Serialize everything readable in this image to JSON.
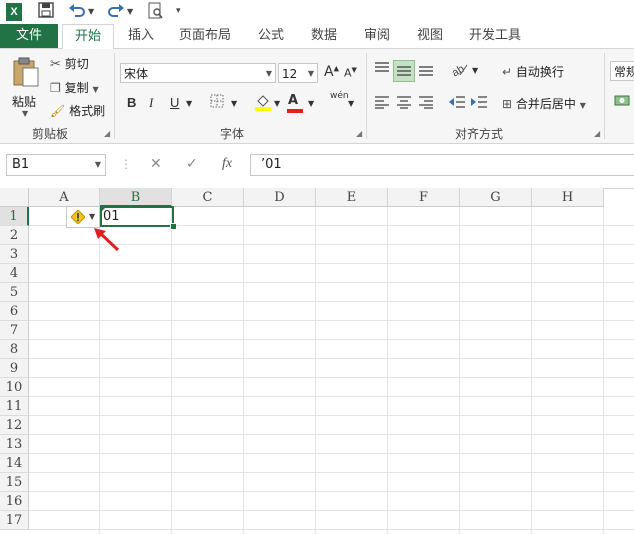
{
  "qat": {
    "excel_icon": "X"
  },
  "tabs": [
    {
      "label": "文件"
    },
    {
      "label": "开始"
    },
    {
      "label": "插入"
    },
    {
      "label": "页面布局"
    },
    {
      "label": "公式"
    },
    {
      "label": "数据"
    },
    {
      "label": "审阅"
    },
    {
      "label": "视图"
    },
    {
      "label": "开发工具"
    }
  ],
  "ribbon": {
    "clipboard": {
      "paste": "粘贴",
      "cut": "剪切",
      "copy": "复制",
      "format_painter": "格式刷",
      "label": "剪贴板"
    },
    "font": {
      "name": "宋体",
      "size": "12",
      "bold": "B",
      "italic": "I",
      "underline": "U",
      "grow": "A",
      "shrink": "A",
      "label": "字体",
      "font_color_glyph": "A",
      "phonetic": "wén"
    },
    "align": {
      "wrap": "自动换行",
      "merge": "合并后居中",
      "label": "对齐方式"
    },
    "number": {
      "format": "常规"
    }
  },
  "formula_bar": {
    "name_box": "B1",
    "cancel": "✕",
    "enter": "✓",
    "fx": "fx",
    "value": "’01"
  },
  "columns": [
    "A",
    "B",
    "C",
    "D",
    "E",
    "F",
    "G",
    "H"
  ],
  "rows": [
    "1",
    "2",
    "3",
    "4",
    "5",
    "6",
    "7",
    "8",
    "9",
    "10",
    "11",
    "12",
    "13",
    "14",
    "15",
    "16",
    "17"
  ],
  "cells": {
    "B1": "01"
  },
  "colors": {
    "accent": "#217346",
    "arrow": "#e02020",
    "warning": "#f5c518"
  }
}
